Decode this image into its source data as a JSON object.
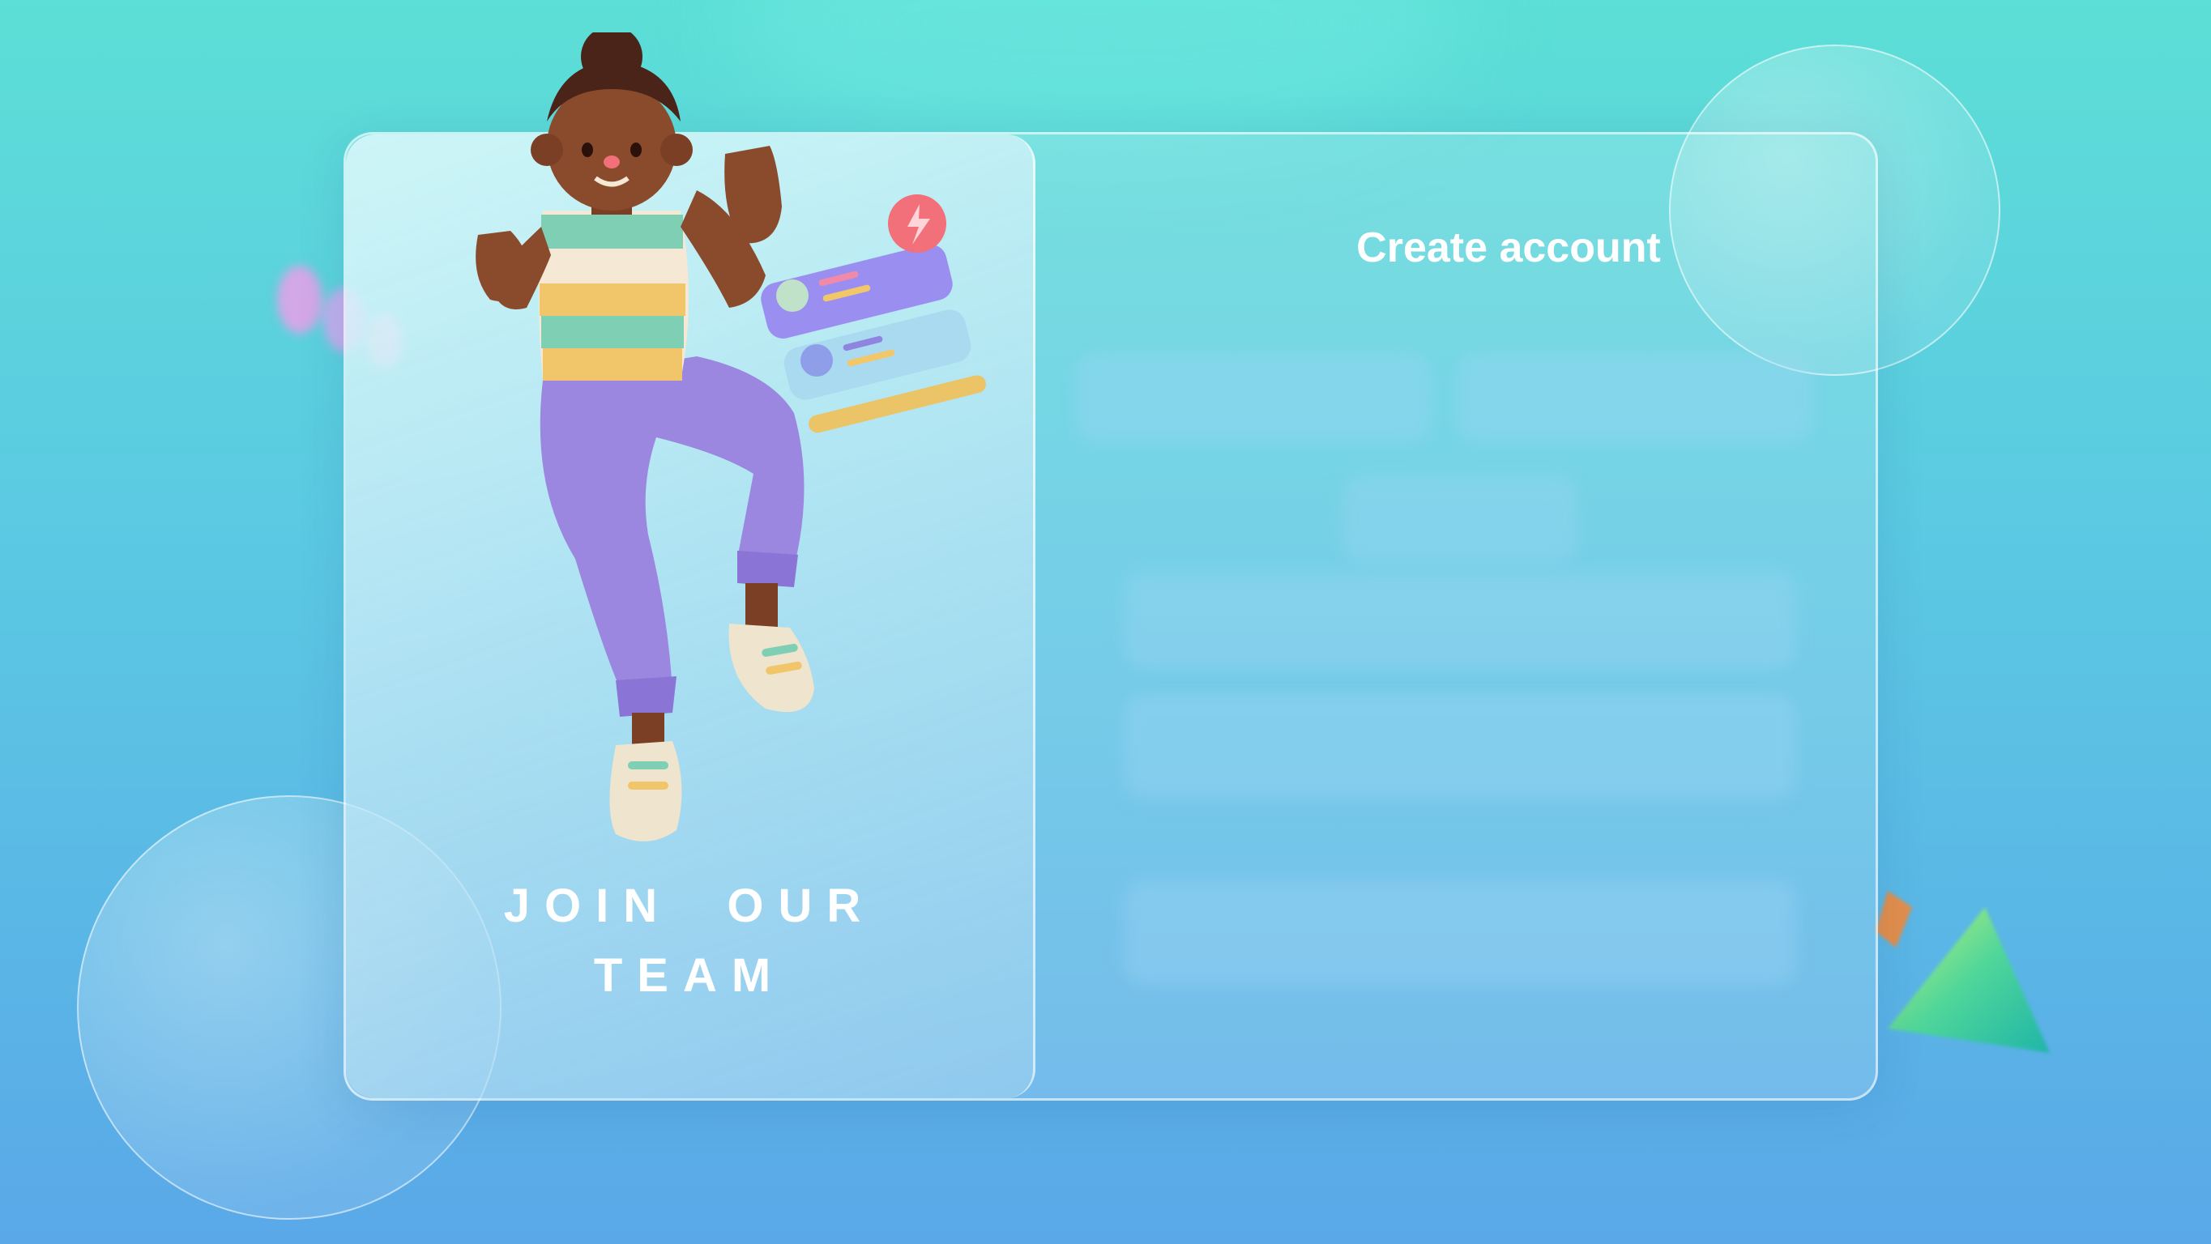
{
  "page": {
    "title": "Create account",
    "left_panel": {
      "tagline_line1": "JOIN  OUR",
      "tagline_line2": "TEAM"
    }
  },
  "colors": {
    "bg_top": "#5cdfd6",
    "bg_bottom": "#5aa8e8",
    "text": "#ffffff",
    "pants": "#9b86e0",
    "shirt_stripe_yellow": "#f1c56a",
    "shirt_stripe_green": "#7fcfb5",
    "skin": "#8a4b2c",
    "shoe": "#efe4cd"
  },
  "icons": [
    "illustration-person",
    "notification-card-icon",
    "lightning-badge-icon"
  ]
}
